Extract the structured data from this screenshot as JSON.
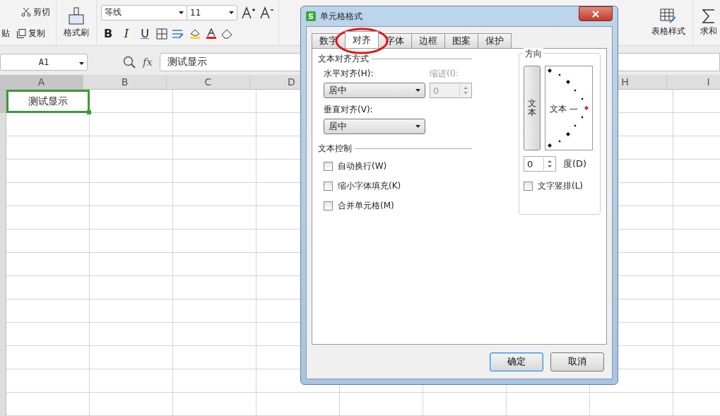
{
  "ribbon": {
    "paste": "贴",
    "cut": "剪切",
    "copy": "复制",
    "format_painter": "格式刷",
    "font": "等线",
    "font_size": "11",
    "bold": "B",
    "italic": "I",
    "underline": "U",
    "table_style": "表格样式",
    "sum": "求和"
  },
  "formula_bar": {
    "name_box": "A1",
    "fx": "fx",
    "value": "测试显示"
  },
  "sheet": {
    "columns": [
      {
        "label": "A",
        "selected": true
      },
      {
        "label": "B",
        "selected": false
      },
      {
        "label": "C",
        "selected": false
      },
      {
        "label": "D",
        "selected": false
      },
      {
        "label": "H",
        "selected": false
      },
      {
        "label": "I",
        "selected": false
      }
    ],
    "cells": [
      {
        "text": "测试显示",
        "selected": true
      }
    ]
  },
  "dialog": {
    "title": "单元格格式",
    "tabs": [
      {
        "label": "数字",
        "selected": false
      },
      {
        "label": "对齐",
        "selected": true
      },
      {
        "label": "字体",
        "selected": false
      },
      {
        "label": "边框",
        "selected": false
      },
      {
        "label": "图案",
        "selected": false
      },
      {
        "label": "保护",
        "selected": false
      }
    ],
    "alignment_group": "文本对齐方式",
    "horizontal": {
      "label": "水平对齐(H):",
      "value": "居中"
    },
    "indent": {
      "label": "缩进(I):",
      "value": "0",
      "disabled": true
    },
    "vertical": {
      "label": "垂直对齐(V):",
      "value": "居中"
    },
    "control_group": "文本控制",
    "checkboxes": [
      {
        "label": "自动换行(W)",
        "checked": false
      },
      {
        "label": "缩小字体填充(K)",
        "checked": false
      },
      {
        "label": "合并单元格(M)",
        "checked": false
      }
    ],
    "orientation": {
      "title": "方向",
      "vertical_text": "文本",
      "dial_text": "文本 —",
      "degrees": "0",
      "degrees_label": "度(D)",
      "stack_label": "文字竖排(L)",
      "stack_checked": false
    },
    "buttons": [
      {
        "label": "确定",
        "selected": true
      },
      {
        "label": "取消",
        "selected": false
      }
    ]
  }
}
